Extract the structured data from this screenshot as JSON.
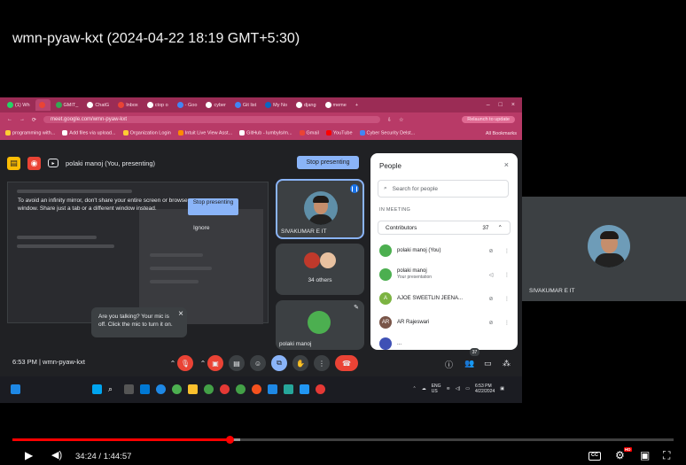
{
  "video": {
    "title": "wmn-pyaw-kxt (2024-04-22 18:19 GMT+5:30)",
    "current_time": "34:24",
    "duration": "1:44:57",
    "time_display": "34:24 / 1:44:57",
    "progress": 0.328,
    "buffered": 0.345,
    "hd_badge": "HD"
  },
  "browser": {
    "tabs": [
      "(1) Wh",
      "",
      "GMIT_",
      "ChatG",
      "Inbox",
      "ctop o",
      "- Goo",
      "cyber",
      "Git list",
      "My No",
      "djang",
      "meme"
    ],
    "new_tab": "+",
    "win_controls": [
      "–",
      "□",
      "×"
    ],
    "url": "meet.google.com/wmn-pyaw-kxt",
    "relaunch": "Relaunch to update",
    "bookmarks": [
      "programming with...",
      "Add files via upload...",
      "Organization Login",
      "Intuit Live View Asst...",
      "GitHub - lumbyls/m...",
      "Gmail",
      "YouTube",
      "Cyber Security Delst...",
      "All Bookmarks"
    ]
  },
  "meet": {
    "presenter_label": "polaki manoj (You, presenting)",
    "stop_presenting": "Stop presenting",
    "mirror_warning": "To avoid an infinity mirror, don't share your entire screen or browser window. Share just a tab or a different window instead.",
    "stop_presenting_mini": "Stop presenting",
    "ignore": "Ignore",
    "mic_tooltip": "Are you talking? Your mic is off. Click the mic to turn it on.",
    "tooltip_close": "×",
    "clock": "6:53 PM",
    "meeting_code": "wmn-pyaw-kxt",
    "clock_line": "6:53 PM  |  wmn-pyaw-kxt",
    "people_badge": "37",
    "tiles": {
      "main_name": "SIVAKUMAR E IT",
      "others_label": "34 others",
      "manoj_name": "polaki manoj"
    },
    "people_panel": {
      "title": "People",
      "close": "×",
      "search_placeholder": "Search for people",
      "section": "IN MEETING",
      "contributors_label": "Contributors",
      "contributors_count": "37",
      "rows": [
        {
          "initial": "",
          "name": "polaki manoj (You)",
          "sub": ""
        },
        {
          "initial": "",
          "name": "polaki manoj",
          "sub": "Your presentation"
        },
        {
          "initial": "A",
          "name": "AJOE SWEETLIN JEENA...",
          "sub": ""
        },
        {
          "initial": "AR",
          "name": "AR Rajeswari",
          "sub": ""
        },
        {
          "initial": "",
          "name": "...",
          "sub": ""
        }
      ]
    }
  },
  "taskbar": {
    "lang": "ENG",
    "region": "US",
    "time": "6:53 PM",
    "date": "4/22/2024"
  },
  "side_tile": {
    "name": "SIVAKUMAR E IT"
  },
  "colors": {
    "chrome_tab_bar": "#9b2c55",
    "chrome_toolbar": "#b83a67",
    "progress_red": "#ff0000",
    "meet_bg": "#202124",
    "accent_blue": "#8ab4f8"
  },
  "icons": [
    "play-icon",
    "volume-icon",
    "subtitles-icon",
    "settings-icon",
    "miniplayer-icon",
    "fullscreen-icon"
  ]
}
